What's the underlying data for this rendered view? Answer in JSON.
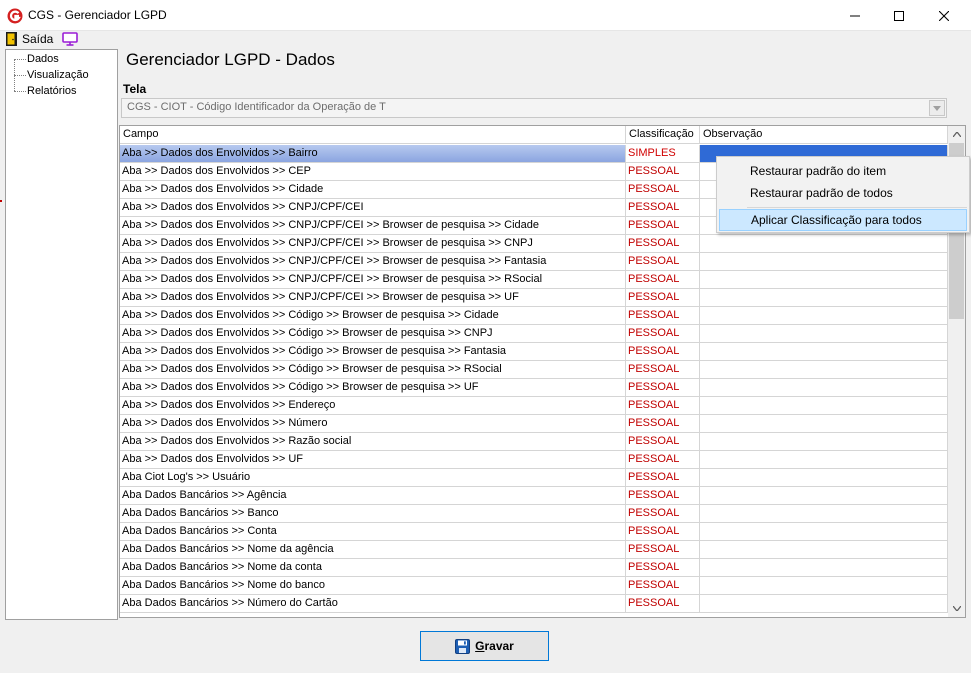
{
  "window": {
    "title": "CGS - Gerenciador LGPD"
  },
  "menu": {
    "exit_label": "Saída"
  },
  "tree": {
    "items": [
      {
        "label": "Dados"
      },
      {
        "label": "Visualização"
      },
      {
        "label": "Relatórios"
      }
    ]
  },
  "main": {
    "title": "Gerenciador LGPD - Dados",
    "tela_label": "Tela",
    "tela_value": "CGS - CIOT - Código Identificador da Operação de T"
  },
  "grid": {
    "headers": {
      "campo": "Campo",
      "classificacao": "Classificação",
      "observacao": "Observação"
    },
    "rows": [
      {
        "campo": "Aba >> Dados dos Envolvidos >> Bairro",
        "classificacao": "SIMPLES",
        "observacao": ""
      },
      {
        "campo": "Aba >> Dados dos Envolvidos >> CEP",
        "classificacao": "PESSOAL",
        "observacao": ""
      },
      {
        "campo": "Aba >> Dados dos Envolvidos >> Cidade",
        "classificacao": "PESSOAL",
        "observacao": ""
      },
      {
        "campo": "Aba >> Dados dos Envolvidos >> CNPJ/CPF/CEI",
        "classificacao": "PESSOAL",
        "observacao": ""
      },
      {
        "campo": "Aba >> Dados dos Envolvidos >> CNPJ/CPF/CEI >> Browser de pesquisa >> Cidade",
        "classificacao": "PESSOAL",
        "observacao": ""
      },
      {
        "campo": "Aba >> Dados dos Envolvidos >> CNPJ/CPF/CEI >> Browser de pesquisa >> CNPJ",
        "classificacao": "PESSOAL",
        "observacao": ""
      },
      {
        "campo": "Aba >> Dados dos Envolvidos >> CNPJ/CPF/CEI >> Browser de pesquisa >> Fantasia",
        "classificacao": "PESSOAL",
        "observacao": ""
      },
      {
        "campo": "Aba >> Dados dos Envolvidos >> CNPJ/CPF/CEI >> Browser de pesquisa >> RSocial",
        "classificacao": "PESSOAL",
        "observacao": ""
      },
      {
        "campo": "Aba >> Dados dos Envolvidos >> CNPJ/CPF/CEI >> Browser de pesquisa >> UF",
        "classificacao": "PESSOAL",
        "observacao": ""
      },
      {
        "campo": "Aba >> Dados dos Envolvidos >> Código >> Browser de pesquisa >> Cidade",
        "classificacao": "PESSOAL",
        "observacao": ""
      },
      {
        "campo": "Aba >> Dados dos Envolvidos >> Código >> Browser de pesquisa >> CNPJ",
        "classificacao": "PESSOAL",
        "observacao": ""
      },
      {
        "campo": "Aba >> Dados dos Envolvidos >> Código >> Browser de pesquisa >> Fantasia",
        "classificacao": "PESSOAL",
        "observacao": ""
      },
      {
        "campo": "Aba >> Dados dos Envolvidos >> Código >> Browser de pesquisa >> RSocial",
        "classificacao": "PESSOAL",
        "observacao": ""
      },
      {
        "campo": "Aba >> Dados dos Envolvidos >> Código >> Browser de pesquisa >> UF",
        "classificacao": "PESSOAL",
        "observacao": ""
      },
      {
        "campo": "Aba >> Dados dos Envolvidos >> Endereço",
        "classificacao": "PESSOAL",
        "observacao": ""
      },
      {
        "campo": "Aba >> Dados dos Envolvidos >> Número",
        "classificacao": "PESSOAL",
        "observacao": ""
      },
      {
        "campo": "Aba >> Dados dos Envolvidos >> Razão social",
        "classificacao": "PESSOAL",
        "observacao": ""
      },
      {
        "campo": "Aba >> Dados dos Envolvidos >> UF",
        "classificacao": "PESSOAL",
        "observacao": ""
      },
      {
        "campo": "Aba Ciot Log's >> Usuário",
        "classificacao": "PESSOAL",
        "observacao": ""
      },
      {
        "campo": "Aba Dados Bancários >> Agência",
        "classificacao": "PESSOAL",
        "observacao": ""
      },
      {
        "campo": "Aba Dados Bancários >> Banco",
        "classificacao": "PESSOAL",
        "observacao": ""
      },
      {
        "campo": "Aba Dados Bancários >> Conta",
        "classificacao": "PESSOAL",
        "observacao": ""
      },
      {
        "campo": "Aba Dados Bancários >> Nome da agência",
        "classificacao": "PESSOAL",
        "observacao": ""
      },
      {
        "campo": "Aba Dados Bancários >> Nome da conta",
        "classificacao": "PESSOAL",
        "observacao": ""
      },
      {
        "campo": "Aba Dados Bancários >> Nome do banco",
        "classificacao": "PESSOAL",
        "observacao": ""
      },
      {
        "campo": "Aba Dados Bancários >> Número do Cartão",
        "classificacao": "PESSOAL",
        "observacao": ""
      }
    ]
  },
  "context_menu": {
    "items": [
      {
        "label": "Restaurar padrão do item"
      },
      {
        "label": "Restaurar padrão de todos"
      },
      {
        "label": "Aplicar Classificação para todos"
      }
    ]
  },
  "footer": {
    "save_label_first": "G",
    "save_label_rest": "ravar"
  },
  "colors": {
    "classification_text": "#c00000",
    "selection": "#2f6ad6",
    "accent_border": "#0078d7",
    "menu_highlight": "#cce8ff"
  }
}
